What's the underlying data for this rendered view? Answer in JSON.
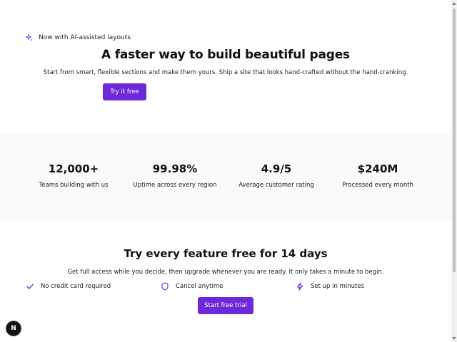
{
  "hero": {
    "badge_text": "Now with AI-assisted layouts",
    "badge_icon": "sparkle-icon",
    "title": "A faster way to build beautiful pages",
    "subtitle": "Start from smart, flexible sections and make them yours. Ship a site that looks hand-crafted without the hand-cranking.",
    "cta_label": "Try it free"
  },
  "stats": [
    {
      "value": "12,000+",
      "label": "Teams building with us"
    },
    {
      "value": "99.98%",
      "label": "Uptime across every region"
    },
    {
      "value": "4.9/5",
      "label": "Average customer rating"
    },
    {
      "value": "$240M",
      "label": "Processed every month"
    }
  ],
  "trial": {
    "title": "Try every feature free for 14 days",
    "subtitle": "Get full access while you decide, then upgrade whenever you are ready. It only takes a minute to begin.",
    "features": [
      {
        "label": "No credit card required",
        "icon": "check-icon"
      },
      {
        "label": "Cancel anytime",
        "icon": "shield-icon"
      },
      {
        "label": "Set up in minutes",
        "icon": "lightning-icon"
      }
    ],
    "cta_label": "Start free trial"
  },
  "dev_badge": {
    "label": "N"
  },
  "colors": {
    "accent": "#6d28d9",
    "stats_background": "#f8fafc",
    "text": "#111111"
  }
}
